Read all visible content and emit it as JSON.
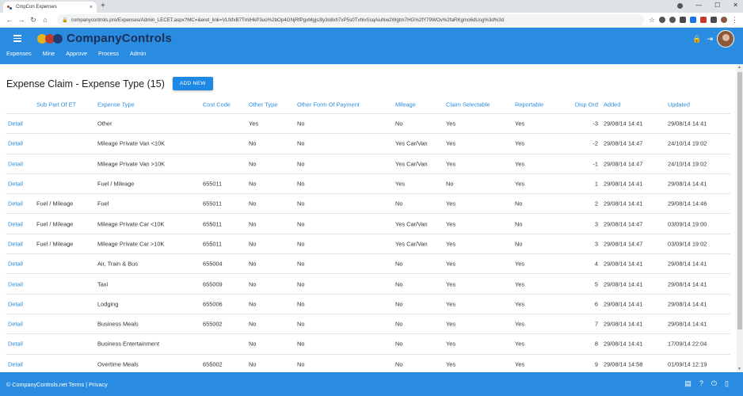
{
  "browser": {
    "tab_title": "CmpCon Expenses",
    "tab_close": "×",
    "new_tab": "+",
    "url": "companycontrols.pro/Expenses/Admin_LECET.aspx?MC=&eret_link=VLNfxB7TmIHkP3uo%2bOp4GNjRfPgxMgjs3ly3o8xh7xP5s0TvhivSsqAiuNw2Wgtm7HG%2fY79WOv%2faRKgmo6dUsg%3d%3d",
    "back": "←",
    "forward": "→",
    "reload": "↻",
    "home": "⌂",
    "star": "☆",
    "minimize": "—",
    "maximize": "☐",
    "close": "✕"
  },
  "app": {
    "brand": "CompanyControls",
    "colors": {
      "header": "#2a8ce0",
      "brand_text": "#1c2e54",
      "link": "#2a8ce0",
      "button": "#1e88e5"
    },
    "nav": [
      "Expenses",
      "Mine",
      "Approve",
      "Process",
      "Admin"
    ],
    "header_icons": {
      "lock": "🔒",
      "logout": "⇥"
    }
  },
  "page": {
    "title": "Expense Claim - Expense Type (15)",
    "add_button": "ADD NEW"
  },
  "table": {
    "headers": [
      "",
      "Sub Part Of ET",
      "Expense Type",
      "Cost Code",
      "Other Type",
      "Other Form Of Payment",
      "Mileage",
      "Claim Selectable",
      "Reportable",
      "Disp Ord",
      "Added",
      "Updated"
    ],
    "rows": [
      [
        "Detail",
        "",
        "Other",
        "",
        "Yes",
        "No",
        "No",
        "Yes",
        "Yes",
        "-3",
        "29/08/14 14:41",
        "29/08/14 14:41"
      ],
      [
        "Detail",
        "",
        "Mileage Private Van <10K",
        "",
        "No",
        "No",
        "Yes Car/Van",
        "Yes",
        "Yes",
        "-2",
        "29/08/14 14:47",
        "24/10/14 19:02"
      ],
      [
        "Detail",
        "",
        "Mileage Private Van >10K",
        "",
        "No",
        "No",
        "Yes Car/Van",
        "Yes",
        "Yes",
        "-1",
        "29/08/14 14:47",
        "24/10/14 19:02"
      ],
      [
        "Detail",
        "",
        "Fuel / Mileage",
        "655011",
        "No",
        "No",
        "Yes",
        "No",
        "Yes",
        "1",
        "29/08/14 14:41",
        "29/08/14 14:41"
      ],
      [
        "Detail",
        "Fuel / Mileage",
        "Fuel",
        "655011",
        "No",
        "No",
        "No",
        "Yes",
        "No",
        "2",
        "29/08/14 14:41",
        "29/08/14 14:46"
      ],
      [
        "Detail",
        "Fuel / Mileage",
        "Mileage Private Car <10K",
        "655011",
        "No",
        "No",
        "Yes Car/Van",
        "Yes",
        "No",
        "3",
        "29/08/14 14:47",
        "03/09/14 19:00"
      ],
      [
        "Detail",
        "Fuel / Mileage",
        "Mileage Private Car >10K",
        "655011",
        "No",
        "No",
        "Yes Car/Van",
        "Yes",
        "No",
        "3",
        "29/08/14 14:47",
        "03/09/14 19:02"
      ],
      [
        "Detail",
        "",
        "Air, Train & Bus",
        "655004",
        "No",
        "No",
        "No",
        "Yes",
        "Yes",
        "4",
        "29/08/14 14:41",
        "29/08/14 14:41"
      ],
      [
        "Detail",
        "",
        "Taxi",
        "655009",
        "No",
        "No",
        "No",
        "Yes",
        "Yes",
        "5",
        "29/08/14 14:41",
        "29/08/14 14:41"
      ],
      [
        "Detail",
        "",
        "Lodging",
        "655006",
        "No",
        "No",
        "No",
        "Yes",
        "Yes",
        "6",
        "29/08/14 14:41",
        "29/08/14 14:41"
      ],
      [
        "Detail",
        "",
        "Business Meals",
        "655002",
        "No",
        "No",
        "No",
        "Yes",
        "Yes",
        "7",
        "29/08/14 14:41",
        "29/08/14 14:41"
      ],
      [
        "Detail",
        "",
        "Business Entertainment",
        "",
        "No",
        "No",
        "No",
        "Yes",
        "Yes",
        "8",
        "29/08/14 14:41",
        "17/09/14 22:04"
      ],
      [
        "Detail",
        "",
        "Overtime Meals",
        "655002",
        "No",
        "No",
        "No",
        "Yes",
        "Yes",
        "9",
        "29/08/14 14:58",
        "01/09/14 12:19"
      ]
    ]
  },
  "footer": {
    "text": "© CompanyControls.net Terms | Privacy",
    "icons": [
      "chat-icon",
      "help-icon",
      "power-icon",
      "mobile-icon"
    ]
  }
}
